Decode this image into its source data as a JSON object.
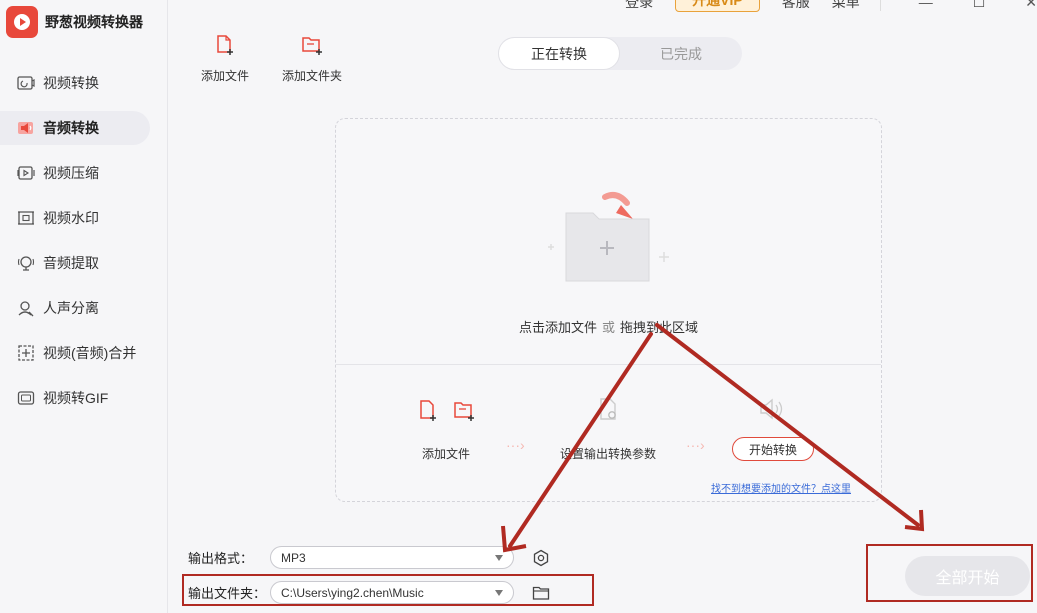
{
  "app": {
    "name": "野葱视频转换器",
    "brand_color": "#e8483b"
  },
  "titlebar": {
    "login": "登录",
    "vip": "开通VIP",
    "service": "客服",
    "menu": "菜单"
  },
  "sidebar": {
    "items": [
      {
        "label": "视频转换",
        "icon": "video-convert-icon"
      },
      {
        "label": "音频转换",
        "icon": "audio-convert-icon",
        "active": true
      },
      {
        "label": "视频压缩",
        "icon": "video-compress-icon"
      },
      {
        "label": "视频水印",
        "icon": "watermark-icon"
      },
      {
        "label": "音频提取",
        "icon": "audio-extract-icon"
      },
      {
        "label": "人声分离",
        "icon": "voice-separate-icon"
      },
      {
        "label": "视频(音频)合并",
        "icon": "merge-icon"
      },
      {
        "label": "视频转GIF",
        "icon": "gif-icon"
      }
    ]
  },
  "toolbar": {
    "add_file": "添加文件",
    "add_folder": "添加文件夹"
  },
  "tabs": {
    "converting": "正在转换",
    "completed": "已完成"
  },
  "dropzone": {
    "click_add": "点击添加文件",
    "or": "或",
    "drag_here": "拖拽到此区域",
    "step1": "添加文件",
    "step2": "设置输出转换参数",
    "step3": "开始转换",
    "help_link": "找不到想要添加的文件？点这里"
  },
  "output": {
    "format_label": "输出格式：",
    "format_value": "MP3",
    "folder_label": "输出文件夹：",
    "folder_value": "C:\\Users\\ying2.chen\\Music"
  },
  "start_all": "全部开始",
  "colors": {
    "accent": "#e8483b",
    "annotation": "#b02a22",
    "link": "#3a6bd8"
  }
}
